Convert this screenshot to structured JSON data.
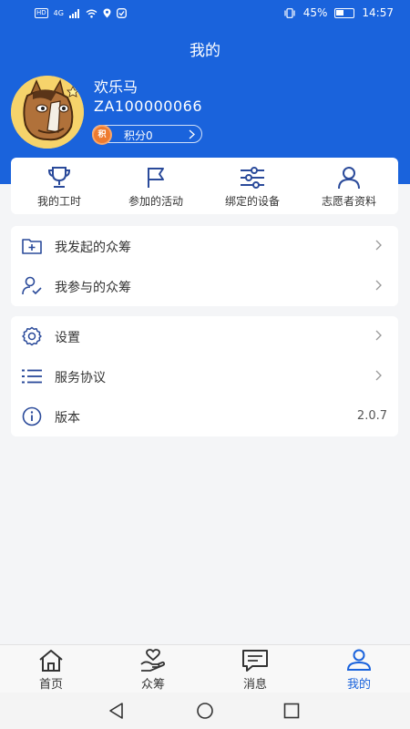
{
  "status_bar": {
    "network": "4G",
    "battery": "45%",
    "time": "14:57"
  },
  "header": {
    "title": "我的"
  },
  "user": {
    "name": "欢乐马",
    "id": "ZA100000066",
    "points_badge": "积",
    "points_label": "积分0"
  },
  "quick_actions": [
    {
      "label": "我的工时",
      "icon": "trophy-icon"
    },
    {
      "label": "参加的活动",
      "icon": "flag-icon"
    },
    {
      "label": "绑定的设备",
      "icon": "sliders-icon"
    },
    {
      "label": "志愿者资料",
      "icon": "person-icon"
    }
  ],
  "crowdfund_menu": [
    {
      "label": "我发起的众筹",
      "icon": "folder-plus-icon"
    },
    {
      "label": "我参与的众筹",
      "icon": "user-check-icon"
    }
  ],
  "settings_menu": [
    {
      "label": "设置",
      "icon": "gear-icon"
    },
    {
      "label": "服务协议",
      "icon": "list-icon"
    },
    {
      "label": "版本",
      "icon": "info-icon",
      "value": "2.0.7"
    }
  ],
  "tabs": [
    {
      "label": "首页",
      "icon": "home-icon",
      "active": false
    },
    {
      "label": "众筹",
      "icon": "heart-hand-icon",
      "active": false
    },
    {
      "label": "消息",
      "icon": "message-icon",
      "active": false
    },
    {
      "label": "我的",
      "icon": "profile-icon",
      "active": true
    }
  ],
  "colors": {
    "primary": "#1a63dc",
    "icon": "#2a4a9a",
    "points_coin": "#ee7b30",
    "tab_inactive": "#333333"
  }
}
